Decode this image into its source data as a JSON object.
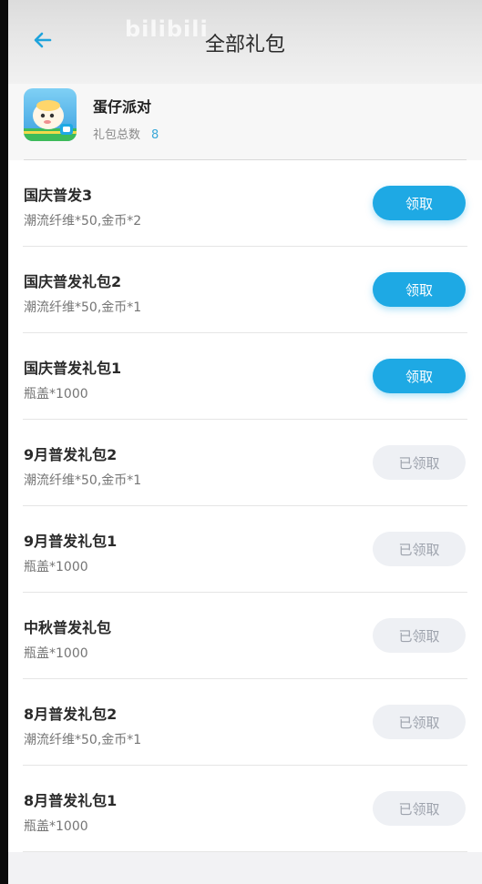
{
  "header": {
    "title": "全部礼包",
    "watermark": "bilibili",
    "back_icon": "arrow-left-icon"
  },
  "game": {
    "name": "蛋仔派对",
    "total_label": "礼包总数",
    "total_count": "8"
  },
  "colors": {
    "accent": "#1ea9e4",
    "count": "#3aa8d8",
    "claimed_bg": "#eef0f4",
    "claimed_text": "#9ea3ad"
  },
  "gifts": [
    {
      "title": "国庆普发3",
      "desc": "潮流纤维*50,金币*2",
      "button": "领取",
      "state": "active"
    },
    {
      "title": "国庆普发礼包2",
      "desc": "潮流纤维*50,金币*1",
      "button": "领取",
      "state": "active"
    },
    {
      "title": "国庆普发礼包1",
      "desc": "瓶盖*1000",
      "button": "领取",
      "state": "active"
    },
    {
      "title": "9月普发礼包2",
      "desc": "潮流纤维*50,金币*1",
      "button": "已领取",
      "state": "claimed"
    },
    {
      "title": "9月普发礼包1",
      "desc": "瓶盖*1000",
      "button": "已领取",
      "state": "claimed"
    },
    {
      "title": "中秋普发礼包",
      "desc": "瓶盖*1000",
      "button": "已领取",
      "state": "claimed"
    },
    {
      "title": "8月普发礼包2",
      "desc": "潮流纤维*50,金币*1",
      "button": "已领取",
      "state": "claimed"
    },
    {
      "title": "8月普发礼包1",
      "desc": "瓶盖*1000",
      "button": "已领取",
      "state": "claimed"
    }
  ]
}
